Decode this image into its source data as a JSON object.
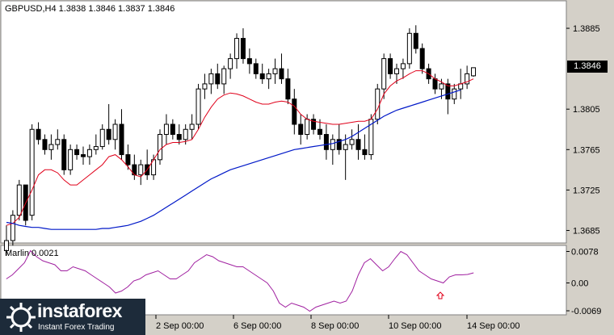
{
  "header": {
    "symbol_label": "GBPUSD,H4  1.3838 1.3846 1.3837 1.3846"
  },
  "price_axis": {
    "ticks": [
      "1.3885",
      "1.3805",
      "1.3765",
      "1.3725",
      "1.3685"
    ],
    "current_price": "1.3846"
  },
  "indicator": {
    "label": "Marlin 0.0021",
    "ticks": [
      "0.0078",
      "0.00",
      "-0.0069"
    ]
  },
  "time_axis": {
    "labels": [
      "2 Sep 00:00",
      "6 Sep 00:00",
      "8 Sep 00:00",
      "10 Sep 00:00",
      "14 Sep 00:00"
    ]
  },
  "logo": {
    "title": "instaforex",
    "subtitle": "Instant Forex Trading"
  },
  "colors": {
    "background": "#ffffff",
    "panel": "#d4d0c8",
    "red_ma": "#e0001a",
    "blue_ma": "#0018c8",
    "marlin": "#a020a0",
    "up_arrow": "#e0001a"
  },
  "chart_data": {
    "type": "candlestick",
    "ylim": [
      1.3675,
      1.3905
    ],
    "ohlc": [
      [
        1.3665,
        1.369,
        1.366,
        1.3675
      ],
      [
        1.3675,
        1.3705,
        1.367,
        1.37
      ],
      [
        1.37,
        1.3735,
        1.3695,
        1.373
      ],
      [
        1.373,
        1.3725,
        1.369,
        1.3695
      ],
      [
        1.37,
        1.379,
        1.3695,
        1.3785
      ],
      [
        1.3785,
        1.3792,
        1.377,
        1.3775
      ],
      [
        1.3775,
        1.378,
        1.376,
        1.3765
      ],
      [
        1.3765,
        1.378,
        1.3755,
        1.377
      ],
      [
        1.377,
        1.3785,
        1.3765,
        1.3775
      ],
      [
        1.3775,
        1.378,
        1.374,
        1.3745
      ],
      [
        1.3745,
        1.377,
        1.374,
        1.3765
      ],
      [
        1.3765,
        1.377,
        1.3755,
        1.376
      ],
      [
        1.376,
        1.3768,
        1.375,
        1.3758
      ],
      [
        1.3758,
        1.377,
        1.375,
        1.3765
      ],
      [
        1.3765,
        1.378,
        1.376,
        1.3768
      ],
      [
        1.3768,
        1.379,
        1.3765,
        1.3785
      ],
      [
        1.3785,
        1.381,
        1.377,
        1.3775
      ],
      [
        1.3775,
        1.3795,
        1.3765,
        1.379
      ],
      [
        1.379,
        1.3805,
        1.3755,
        1.376
      ],
      [
        1.376,
        1.377,
        1.3745,
        1.375
      ],
      [
        1.375,
        1.376,
        1.3735,
        1.374
      ],
      [
        1.374,
        1.3755,
        1.373,
        1.375
      ],
      [
        1.375,
        1.3765,
        1.3735,
        1.374
      ],
      [
        1.374,
        1.376,
        1.3735,
        1.3755
      ],
      [
        1.3755,
        1.3785,
        1.375,
        1.378
      ],
      [
        1.378,
        1.38,
        1.377,
        1.379
      ],
      [
        1.379,
        1.3795,
        1.3775,
        1.378
      ],
      [
        1.378,
        1.379,
        1.377,
        1.3775
      ],
      [
        1.3775,
        1.379,
        1.377,
        1.3785
      ],
      [
        1.3785,
        1.38,
        1.3775,
        1.379
      ],
      [
        1.379,
        1.383,
        1.3785,
        1.3825
      ],
      [
        1.3825,
        1.384,
        1.3815,
        1.383
      ],
      [
        1.383,
        1.3845,
        1.382,
        1.384
      ],
      [
        1.384,
        1.385,
        1.3825,
        1.383
      ],
      [
        1.383,
        1.3848,
        1.382,
        1.3845
      ],
      [
        1.3845,
        1.386,
        1.3835,
        1.3855
      ],
      [
        1.3855,
        1.388,
        1.3845,
        1.3875
      ],
      [
        1.3875,
        1.3885,
        1.385,
        1.3855
      ],
      [
        1.3855,
        1.3865,
        1.384,
        1.385
      ],
      [
        1.385,
        1.3855,
        1.3835,
        1.384
      ],
      [
        1.384,
        1.385,
        1.383,
        1.3835
      ],
      [
        1.3835,
        1.3845,
        1.3825,
        1.384
      ],
      [
        1.384,
        1.3855,
        1.383,
        1.3845
      ],
      [
        1.3845,
        1.386,
        1.383,
        1.3835
      ],
      [
        1.3835,
        1.3845,
        1.381,
        1.3815
      ],
      [
        1.3815,
        1.3825,
        1.378,
        1.379
      ],
      [
        1.379,
        1.38,
        1.377,
        1.378
      ],
      [
        1.378,
        1.38,
        1.3775,
        1.3795
      ],
      [
        1.3795,
        1.38,
        1.378,
        1.3785
      ],
      [
        1.3785,
        1.3795,
        1.3775,
        1.378
      ],
      [
        1.378,
        1.379,
        1.3755,
        1.3765
      ],
      [
        1.3765,
        1.378,
        1.375,
        1.3775
      ],
      [
        1.3775,
        1.379,
        1.376,
        1.3765
      ],
      [
        1.3765,
        1.378,
        1.3735,
        1.377
      ],
      [
        1.377,
        1.3785,
        1.3765,
        1.3775
      ],
      [
        1.3775,
        1.379,
        1.3755,
        1.3765
      ],
      [
        1.3765,
        1.378,
        1.3755,
        1.376
      ],
      [
        1.376,
        1.38,
        1.3755,
        1.3795
      ],
      [
        1.3795,
        1.383,
        1.379,
        1.3825
      ],
      [
        1.3825,
        1.386,
        1.3815,
        1.3855
      ],
      [
        1.3855,
        1.386,
        1.3835,
        1.384
      ],
      [
        1.384,
        1.385,
        1.383,
        1.3845
      ],
      [
        1.3845,
        1.3855,
        1.3835,
        1.385
      ],
      [
        1.385,
        1.3885,
        1.3845,
        1.388
      ],
      [
        1.388,
        1.3888,
        1.386,
        1.3865
      ],
      [
        1.3865,
        1.387,
        1.384,
        1.3845
      ],
      [
        1.3845,
        1.385,
        1.383,
        1.3835
      ],
      [
        1.3835,
        1.384,
        1.382,
        1.3825
      ],
      [
        1.3825,
        1.3835,
        1.3815,
        1.383
      ],
      [
        1.383,
        1.3835,
        1.38,
        1.3815
      ],
      [
        1.3815,
        1.383,
        1.381,
        1.3825
      ],
      [
        1.3825,
        1.3845,
        1.3815,
        1.383
      ],
      [
        1.383,
        1.3848,
        1.3825,
        1.384
      ],
      [
        1.3838,
        1.3846,
        1.3837,
        1.3846
      ]
    ],
    "red_ma": [
      1.369,
      1.3692,
      1.3698,
      1.3712,
      1.3725,
      1.374,
      1.3745,
      1.3745,
      1.3742,
      1.3735,
      1.373,
      1.373,
      1.3735,
      1.374,
      1.3745,
      1.375,
      1.3758,
      1.376,
      1.3755,
      1.3748,
      1.374,
      1.3738,
      1.3745,
      1.3755,
      1.3765,
      1.377,
      1.3772,
      1.3772,
      1.3773,
      1.3775,
      1.3785,
      1.3797,
      1.3807,
      1.3815,
      1.3819,
      1.3821,
      1.382,
      1.3818,
      1.3815,
      1.3812,
      1.381,
      1.381,
      1.3812,
      1.3813,
      1.3812,
      1.3808,
      1.38,
      1.3795,
      1.3793,
      1.3792,
      1.3791,
      1.379,
      1.379,
      1.3791,
      1.3792,
      1.3793,
      1.3793,
      1.3795,
      1.3805,
      1.382,
      1.3828,
      1.3833,
      1.3836,
      1.384,
      1.3843,
      1.3843,
      1.384,
      1.3835,
      1.3832,
      1.3828,
      1.3828,
      1.383,
      1.3832,
      1.3835
    ],
    "blue_ma": [
      1.3693,
      1.3692,
      1.369,
      1.3689,
      1.3688,
      1.3688,
      1.3687,
      1.3686,
      1.3686,
      1.3686,
      1.3686,
      1.3686,
      1.3686,
      1.3686,
      1.3686,
      1.3687,
      1.3687,
      1.3688,
      1.3689,
      1.369,
      1.3692,
      1.3694,
      1.3697,
      1.37,
      1.3704,
      1.3708,
      1.3712,
      1.3716,
      1.372,
      1.3724,
      1.3728,
      1.3732,
      1.3736,
      1.3739,
      1.3742,
      1.3745,
      1.3747,
      1.3749,
      1.3751,
      1.3753,
      1.3755,
      1.3757,
      1.3759,
      1.3761,
      1.3763,
      1.3765,
      1.3766,
      1.3767,
      1.3768,
      1.3769,
      1.377,
      1.3771,
      1.3773,
      1.3775,
      1.3778,
      1.3782,
      1.3786,
      1.379,
      1.3794,
      1.3798,
      1.3801,
      1.3804,
      1.3806,
      1.3808,
      1.381,
      1.3812,
      1.3814,
      1.3816,
      1.3818,
      1.382,
      1.3822,
      1.3824
    ],
    "marlin": [
      0.001,
      0.002,
      0.0035,
      0.005,
      0.008,
      0.0065,
      0.0055,
      0.005,
      0.0045,
      0.003,
      0.003,
      0.004,
      0.0035,
      0.003,
      0.002,
      0.001,
      0.0,
      -0.001,
      -0.0025,
      -0.002,
      -0.001,
      0.0005,
      0.001,
      0.002,
      0.0025,
      0.003,
      0.002,
      0.001,
      0.001,
      0.002,
      0.003,
      0.005,
      0.006,
      0.007,
      0.0065,
      0.0055,
      0.005,
      0.0045,
      0.004,
      0.004,
      0.003,
      0.002,
      0.001,
      0.0,
      -0.002,
      -0.005,
      -0.006,
      -0.005,
      -0.0055,
      -0.006,
      -0.007,
      -0.006,
      -0.0055,
      -0.005,
      -0.0045,
      -0.005,
      -0.0045,
      -0.002,
      0.002,
      0.005,
      0.006,
      0.0045,
      0.003,
      0.004,
      0.006,
      0.0078,
      0.007,
      0.005,
      0.003,
      0.002,
      0.001,
      0.0005,
      0.0,
      0.0015,
      0.002,
      0.002,
      0.0021,
      0.0025
    ],
    "marlin_ylim": [
      -0.0075,
      0.0085
    ]
  }
}
